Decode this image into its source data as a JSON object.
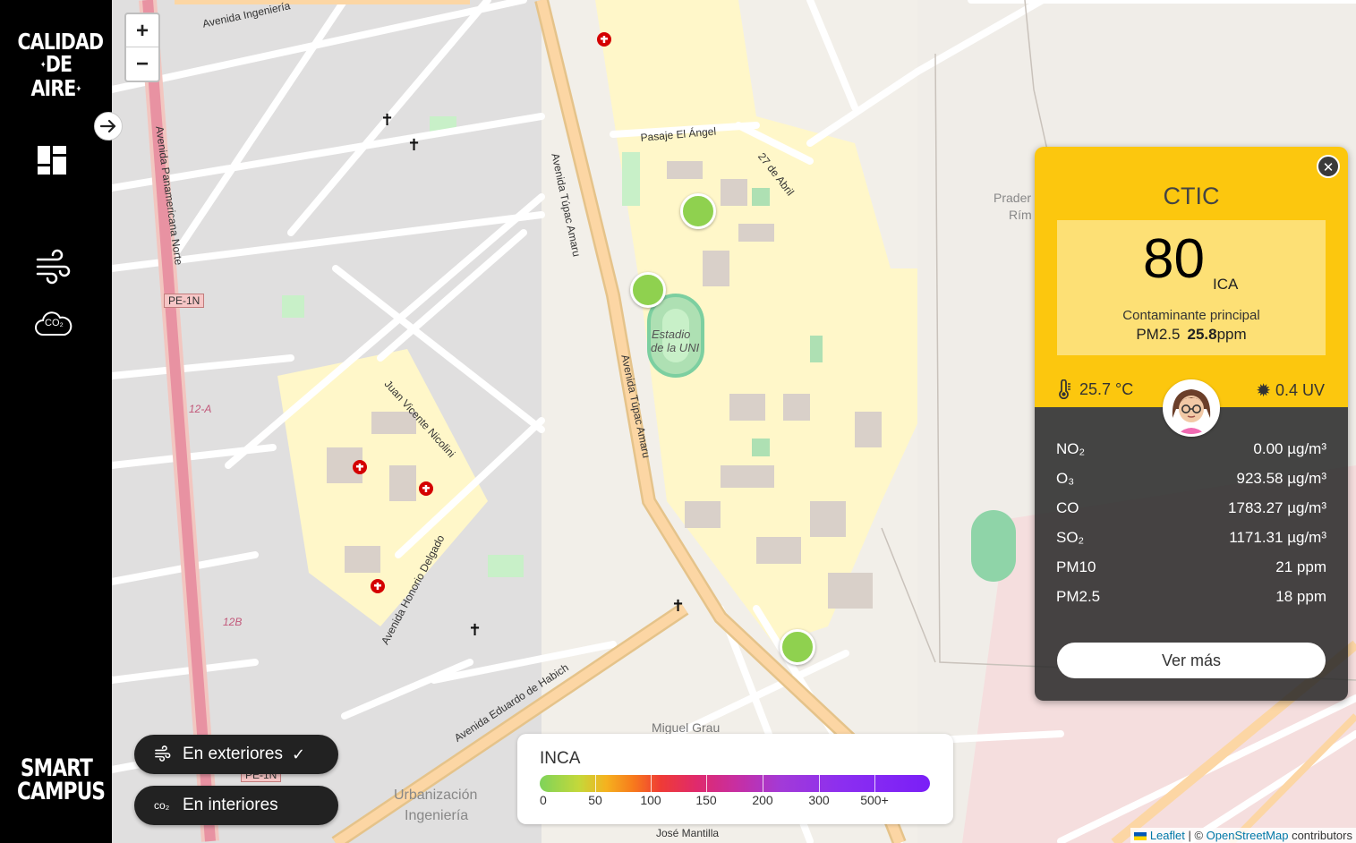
{
  "sidebar": {
    "logo_top_line1": "CALIDAD",
    "logo_top_line2": "DE AIRE",
    "logo_bottom_line1": "SMART",
    "logo_bottom_line2": "CAMPUS",
    "collapse_icon": "arrow-right-icon",
    "nav_items": [
      {
        "name": "dashboard",
        "icon": "dashboard-icon"
      },
      {
        "name": "air",
        "icon": "wind-icon"
      },
      {
        "name": "co2",
        "icon": "co2-cloud-icon",
        "icon_text": "CO₂"
      }
    ]
  },
  "map": {
    "zoom_in": "+",
    "zoom_out": "−",
    "labels": {
      "stadium1": "Estadio",
      "stadium2": "de la UNI",
      "urb1": "Urbanización",
      "urb2": "Ingeniería",
      "miguel_grau": "Miguel Grau",
      "pe1n_a": "PE-1N",
      "pe1n_b": "PE-1N",
      "av_panamericana": "Avenida Panamericana Norte",
      "av_tupac1": "Avenida Túpac Amaru",
      "av_tupac2": "Avenida Túpac Amaru",
      "av_habich": "Avenida Eduardo de Habich",
      "av_ingenieria": "Avenida Ingeniería",
      "pasaje_angel": "Pasaje El Ángel",
      "abril": "27 de Abril",
      "juan_nicolini": "Juan Vicente Nicolini",
      "honorio": "Avenida Honorio Delgado",
      "route12a": "12-A",
      "route12b": "12B",
      "jose_mantilla": "José Mantilla",
      "pradera": "Prader",
      "rim": "Rím"
    }
  },
  "filters": {
    "outdoor_label": "En exteriores",
    "outdoor_icon": "wind-icon",
    "outdoor_check": "✓",
    "indoor_label": "En interiores",
    "indoor_icon": "co2-icon",
    "indoor_icon_text": "co₂"
  },
  "legend": {
    "title": "INCA",
    "ticks": [
      "0",
      "50",
      "100",
      "150",
      "200",
      "300",
      "500+"
    ]
  },
  "station": {
    "name": "CTIC",
    "aqi": "80",
    "aqi_unit": "ICA",
    "main_pollutant_label": "Contaminante principal",
    "main_pollutant": "PM2.5",
    "main_pollutant_value": "25.8",
    "main_pollutant_unit": "ppm",
    "temperature": "25.7 °C",
    "temperature_icon": "thermometer-icon",
    "uv": "0.4 UV",
    "uv_icon": "sun-icon",
    "avatar_icon": "avatar-girl-icon",
    "close_icon": "close-icon",
    "readings": [
      {
        "name": "NO₂",
        "value": "0.00 µg/m³"
      },
      {
        "name": "O₃",
        "value": "923.58 µg/m³"
      },
      {
        "name": "CO",
        "value": "1783.27 µg/m³"
      },
      {
        "name": "SO₂",
        "value": "1171.31 µg/m³"
      },
      {
        "name": "PM10",
        "value": "21 ppm"
      },
      {
        "name": "PM2.5",
        "value": "18 ppm"
      }
    ],
    "more_button": "Ver más"
  },
  "attribution": {
    "leaflet": "Leaflet",
    "sep": " | © ",
    "osm": "OpenStreetMap",
    "contributors": " contributors"
  },
  "colors": {
    "sidebar_bg": "#000000",
    "card_header": "#fcc70e",
    "aqi_box": "#fde075",
    "marker": "#8fd14f"
  }
}
